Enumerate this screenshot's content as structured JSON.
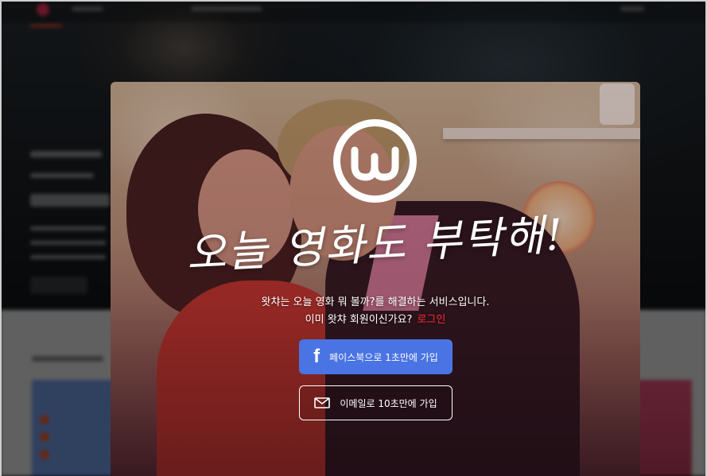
{
  "modal": {
    "headline": "오늘 영화도 부탁해!",
    "description_line1": "왓챠는 오늘 영화 뭐 볼까?를 해결하는 서비스입니다.",
    "description_line2": "이미 왓챠 회원이신가요?",
    "login_link": "로그인",
    "facebook_button": {
      "icon": "facebook-icon",
      "label": "페이스북으로 1초만에 가입"
    },
    "email_button": {
      "icon": "mail-icon",
      "label": "이메일로 10초만에 가입"
    }
  },
  "colors": {
    "facebook_blue": "#4a74e4",
    "login_red": "#ff2e3a",
    "brand_nav_accent": "#ff4a3a"
  }
}
